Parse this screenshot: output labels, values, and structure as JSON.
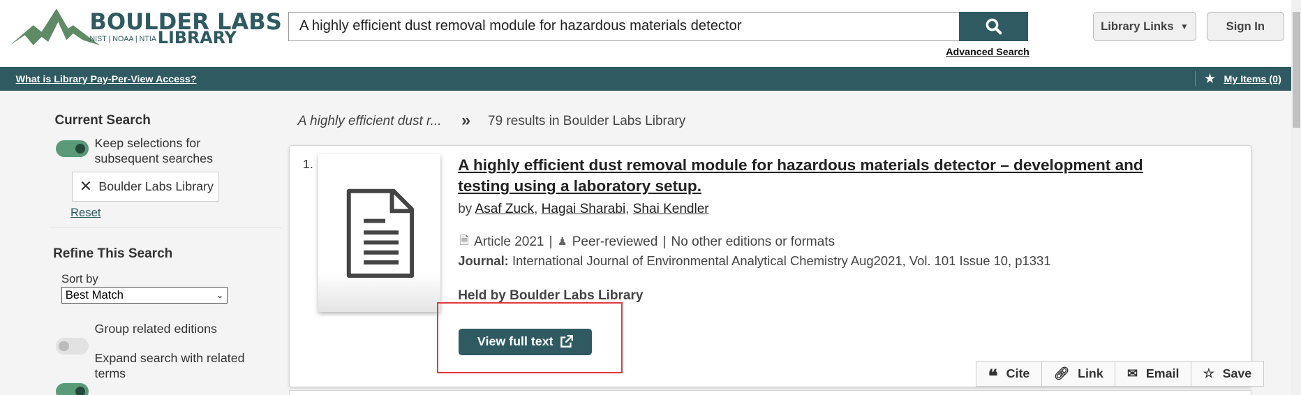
{
  "header": {
    "logo": {
      "line1": "BOULDER LABS",
      "line2": "LIBRARY",
      "sub": "NIST | NOAA | NTIA"
    },
    "search_value": "A highly efficient dust removal module for hazardous materials detector",
    "advanced_search": "Advanced Search",
    "library_links": "Library Links",
    "sign_in": "Sign In"
  },
  "bar": {
    "ppv_link": "What is Library Pay-Per-View Access?",
    "my_items": "My Items (0)"
  },
  "sidebar": {
    "current_search": "Current Search",
    "keep_selections": "Keep selections for subsequent searches",
    "keep_on": true,
    "filter_chip": "Boulder Labs Library",
    "reset": "Reset",
    "refine": "Refine This Search",
    "sort_label": "Sort by",
    "sort_value": "Best Match",
    "group_related": "Group related editions",
    "group_on": false,
    "expand_related": "Expand search with related terms",
    "expand_on": true
  },
  "results": {
    "query_short": "A highly efficient dust r...",
    "count_text": "79 results in Boulder Labs Library",
    "items": [
      {
        "number": "1.",
        "title": "A highly efficient dust removal module for hazardous materials detector – development and testing using a laboratory setup.",
        "by": "by",
        "authors": [
          "Asaf Zuck",
          "Hagai Sharabi",
          "Shai Kendler"
        ],
        "format": "Article 2021",
        "peer": "Peer-reviewed",
        "editions": "No other editions or formats",
        "journal_label": "Journal:",
        "journal": "International Journal of Environmental Analytical Chemistry Aug2021, Vol. 101 Issue 10, p1331",
        "held_by": "Held by Boulder Labs Library",
        "view_full_text": "View full text",
        "actions": [
          "Cite",
          "Link",
          "Email",
          "Save"
        ]
      }
    ]
  },
  "colors": {
    "brand": "#2f5a61",
    "highlight": "#e0393e",
    "toggle_on": "#5a9a78"
  }
}
